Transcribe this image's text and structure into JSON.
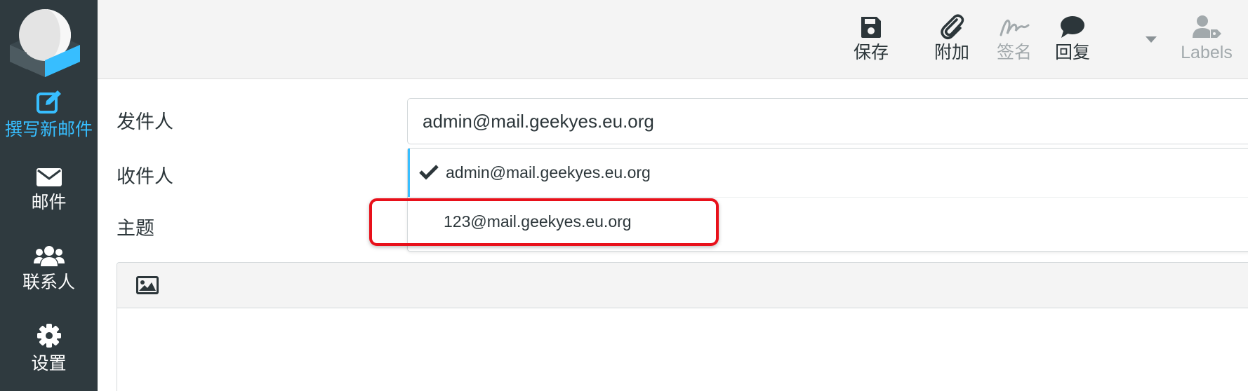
{
  "sidebar": {
    "items": [
      {
        "label": "撰写新邮件",
        "icon": "compose-icon",
        "active": true
      },
      {
        "label": "邮件",
        "icon": "envelope-icon",
        "active": false
      },
      {
        "label": "联系人",
        "icon": "contacts-icon",
        "active": false
      },
      {
        "label": "设置",
        "icon": "gear-icon",
        "active": false
      }
    ]
  },
  "toolbar": {
    "save_label": "保存",
    "attach_label": "附加",
    "signature_label": "签名",
    "responses_label": "回复",
    "labels_label": "Labels"
  },
  "form": {
    "from_label": "发件人",
    "from_value": "admin@mail.geekyes.eu.org",
    "to_label": "收件人",
    "subject_label": "主题"
  },
  "suggestions": [
    {
      "address": "admin@mail.geekyes.eu.org",
      "selected": true
    },
    {
      "address": "123@mail.geekyes.eu.org",
      "selected": false
    }
  ],
  "colors": {
    "sidebar_bg": "#2f3a3f",
    "accent": "#37beff",
    "highlight": "#e8101a"
  }
}
